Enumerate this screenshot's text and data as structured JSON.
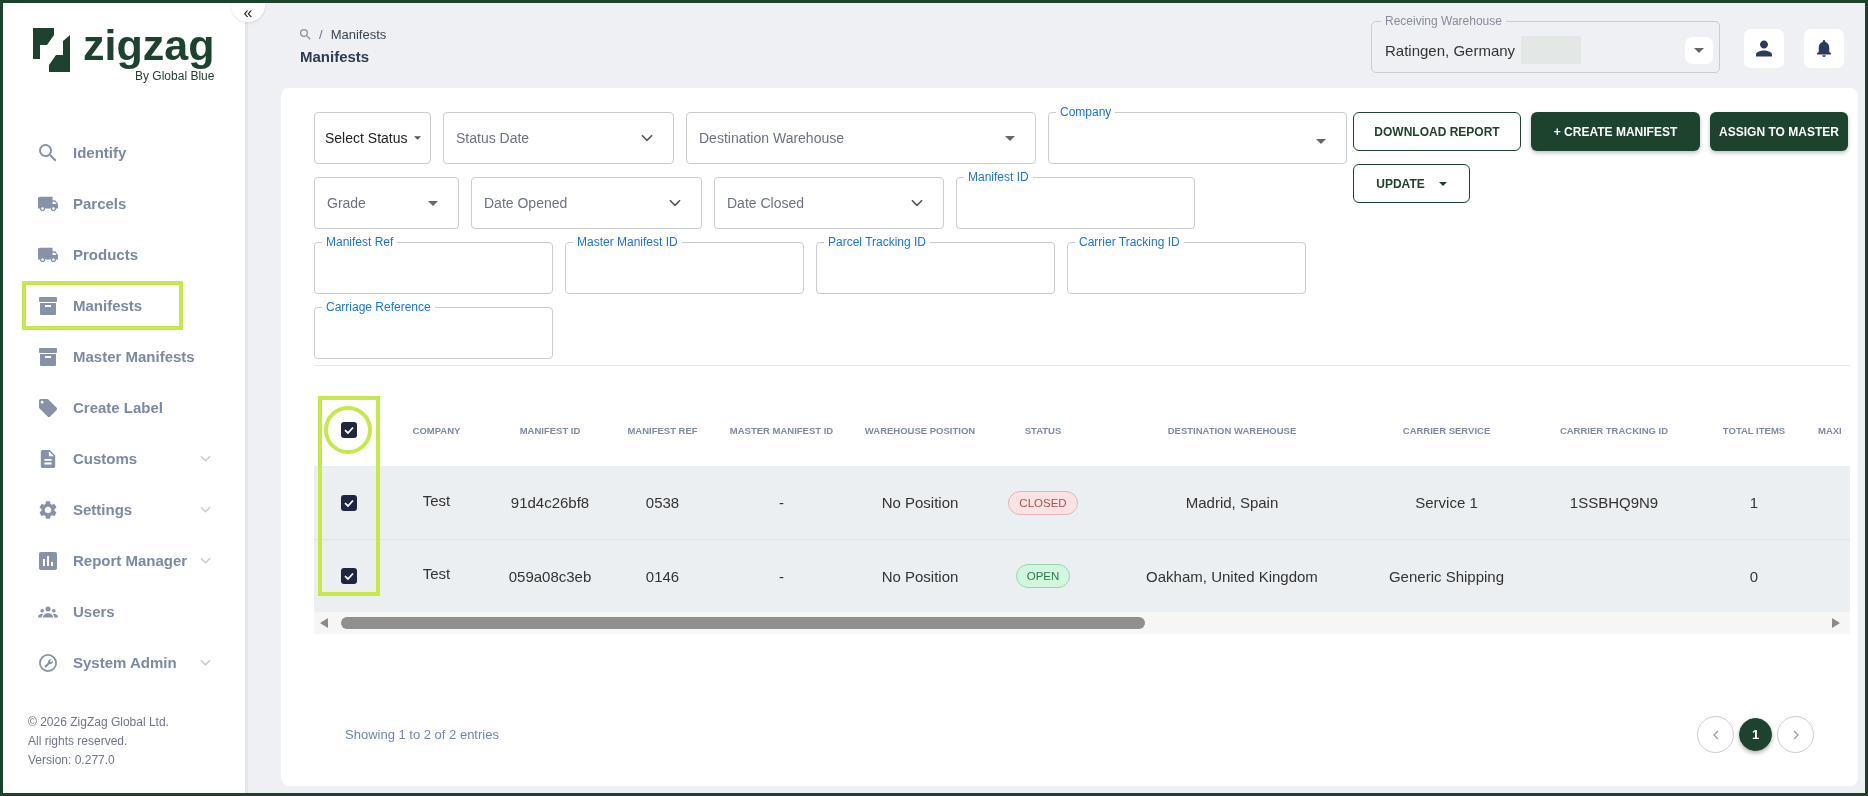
{
  "sidebar": {
    "collapse_button": "«",
    "logo": {
      "wordmark": "zigzag",
      "tagline": "By Global Blue"
    },
    "items": [
      {
        "label": "Identify",
        "kind": "link",
        "highlighted": false
      },
      {
        "label": "Parcels",
        "kind": "link",
        "highlighted": false
      },
      {
        "label": "Products",
        "kind": "link",
        "highlighted": false
      },
      {
        "label": "Manifests",
        "kind": "link",
        "highlighted": true
      },
      {
        "label": "Master Manifests",
        "kind": "link",
        "highlighted": false
      },
      {
        "label": "Create Label",
        "kind": "link",
        "highlighted": false
      },
      {
        "label": "Customs",
        "kind": "group",
        "highlighted": false
      },
      {
        "label": "Settings",
        "kind": "group",
        "highlighted": false
      },
      {
        "label": "Report Manager",
        "kind": "group",
        "highlighted": false
      },
      {
        "label": "Users",
        "kind": "link",
        "highlighted": false
      },
      {
        "label": "System Admin",
        "kind": "group",
        "highlighted": false
      }
    ],
    "footer": [
      "© 2026 ZigZag Global Ltd.",
      "All rights reserved.",
      "Version: 0.277.0"
    ]
  },
  "header": {
    "breadcrumb": {
      "separator": "/",
      "current": "Manifests"
    },
    "title": "Manifests",
    "warehouse_select": {
      "label": "Receiving Warehouse",
      "value": "Ratingen, Germany",
      "redacted": true
    }
  },
  "filters": [
    [
      {
        "kind": "select",
        "value": "Select Status"
      },
      {
        "kind": "date",
        "placeholder": "Status Date"
      },
      {
        "kind": "dropdown",
        "placeholder": "Destination Warehouse"
      },
      {
        "kind": "combo",
        "label": "Company"
      }
    ],
    [
      {
        "kind": "dropdown",
        "placeholder": "Grade"
      },
      {
        "kind": "date",
        "placeholder": "Date Opened"
      },
      {
        "kind": "date",
        "placeholder": "Date Closed"
      },
      {
        "kind": "text",
        "label": "Manifest ID"
      }
    ],
    [
      {
        "kind": "text",
        "label": "Manifest Ref"
      },
      {
        "kind": "text",
        "label": "Master Manifest ID"
      },
      {
        "kind": "text",
        "label": "Parcel Tracking ID"
      },
      {
        "kind": "text",
        "label": "Carrier Tracking ID"
      }
    ],
    [
      {
        "kind": "text",
        "label": "Carriage Reference"
      }
    ]
  ],
  "actions": [
    {
      "label": "DOWNLOAD REPORT",
      "kind": "outlined"
    },
    {
      "label": "+ CREATE MANIFEST",
      "kind": "filled"
    },
    {
      "label": "ASSIGN TO MASTER",
      "kind": "filled"
    },
    {
      "label": "UPDATE",
      "kind": "menu"
    }
  ],
  "table": {
    "all_checked": true,
    "checkbox_column_highlighted": true,
    "columns": [
      "COMPANY",
      "MANIFEST ID",
      "MANIFEST REF",
      "MASTER MANIFEST ID",
      "WAREHOUSE POSITION",
      "STATUS",
      "DESTINATION WAREHOUSE",
      "CARRIER SERVICE",
      "CARRIER TRACKING ID",
      "TOTAL ITEMS",
      "MAXI"
    ],
    "rows": [
      {
        "checked": true,
        "company": "Test",
        "manifest_id": "91d4c26bf8",
        "manifest_ref": "0538",
        "master_manifest_id": "-",
        "warehouse_position": "No Position",
        "status": {
          "label": "CLOSED",
          "kind": "closed"
        },
        "destination_warehouse": "Madrid, Spain",
        "carrier_service": "Service 1",
        "carrier_tracking_id": "1SSBHQ9N9",
        "total_items": "1"
      },
      {
        "checked": true,
        "company": "Test",
        "manifest_id": "059a08c3eb",
        "manifest_ref": "0146",
        "master_manifest_id": "-",
        "warehouse_position": "No Position",
        "status": {
          "label": "OPEN",
          "kind": "open"
        },
        "destination_warehouse": "Oakham, United Kingdom",
        "carrier_service": "Generic Shipping",
        "total_items": "0"
      }
    ]
  },
  "pagination": {
    "summary": "Showing 1 to 2 of 2 entries",
    "pages": [
      {
        "label": "1",
        "selected": true
      }
    ]
  }
}
